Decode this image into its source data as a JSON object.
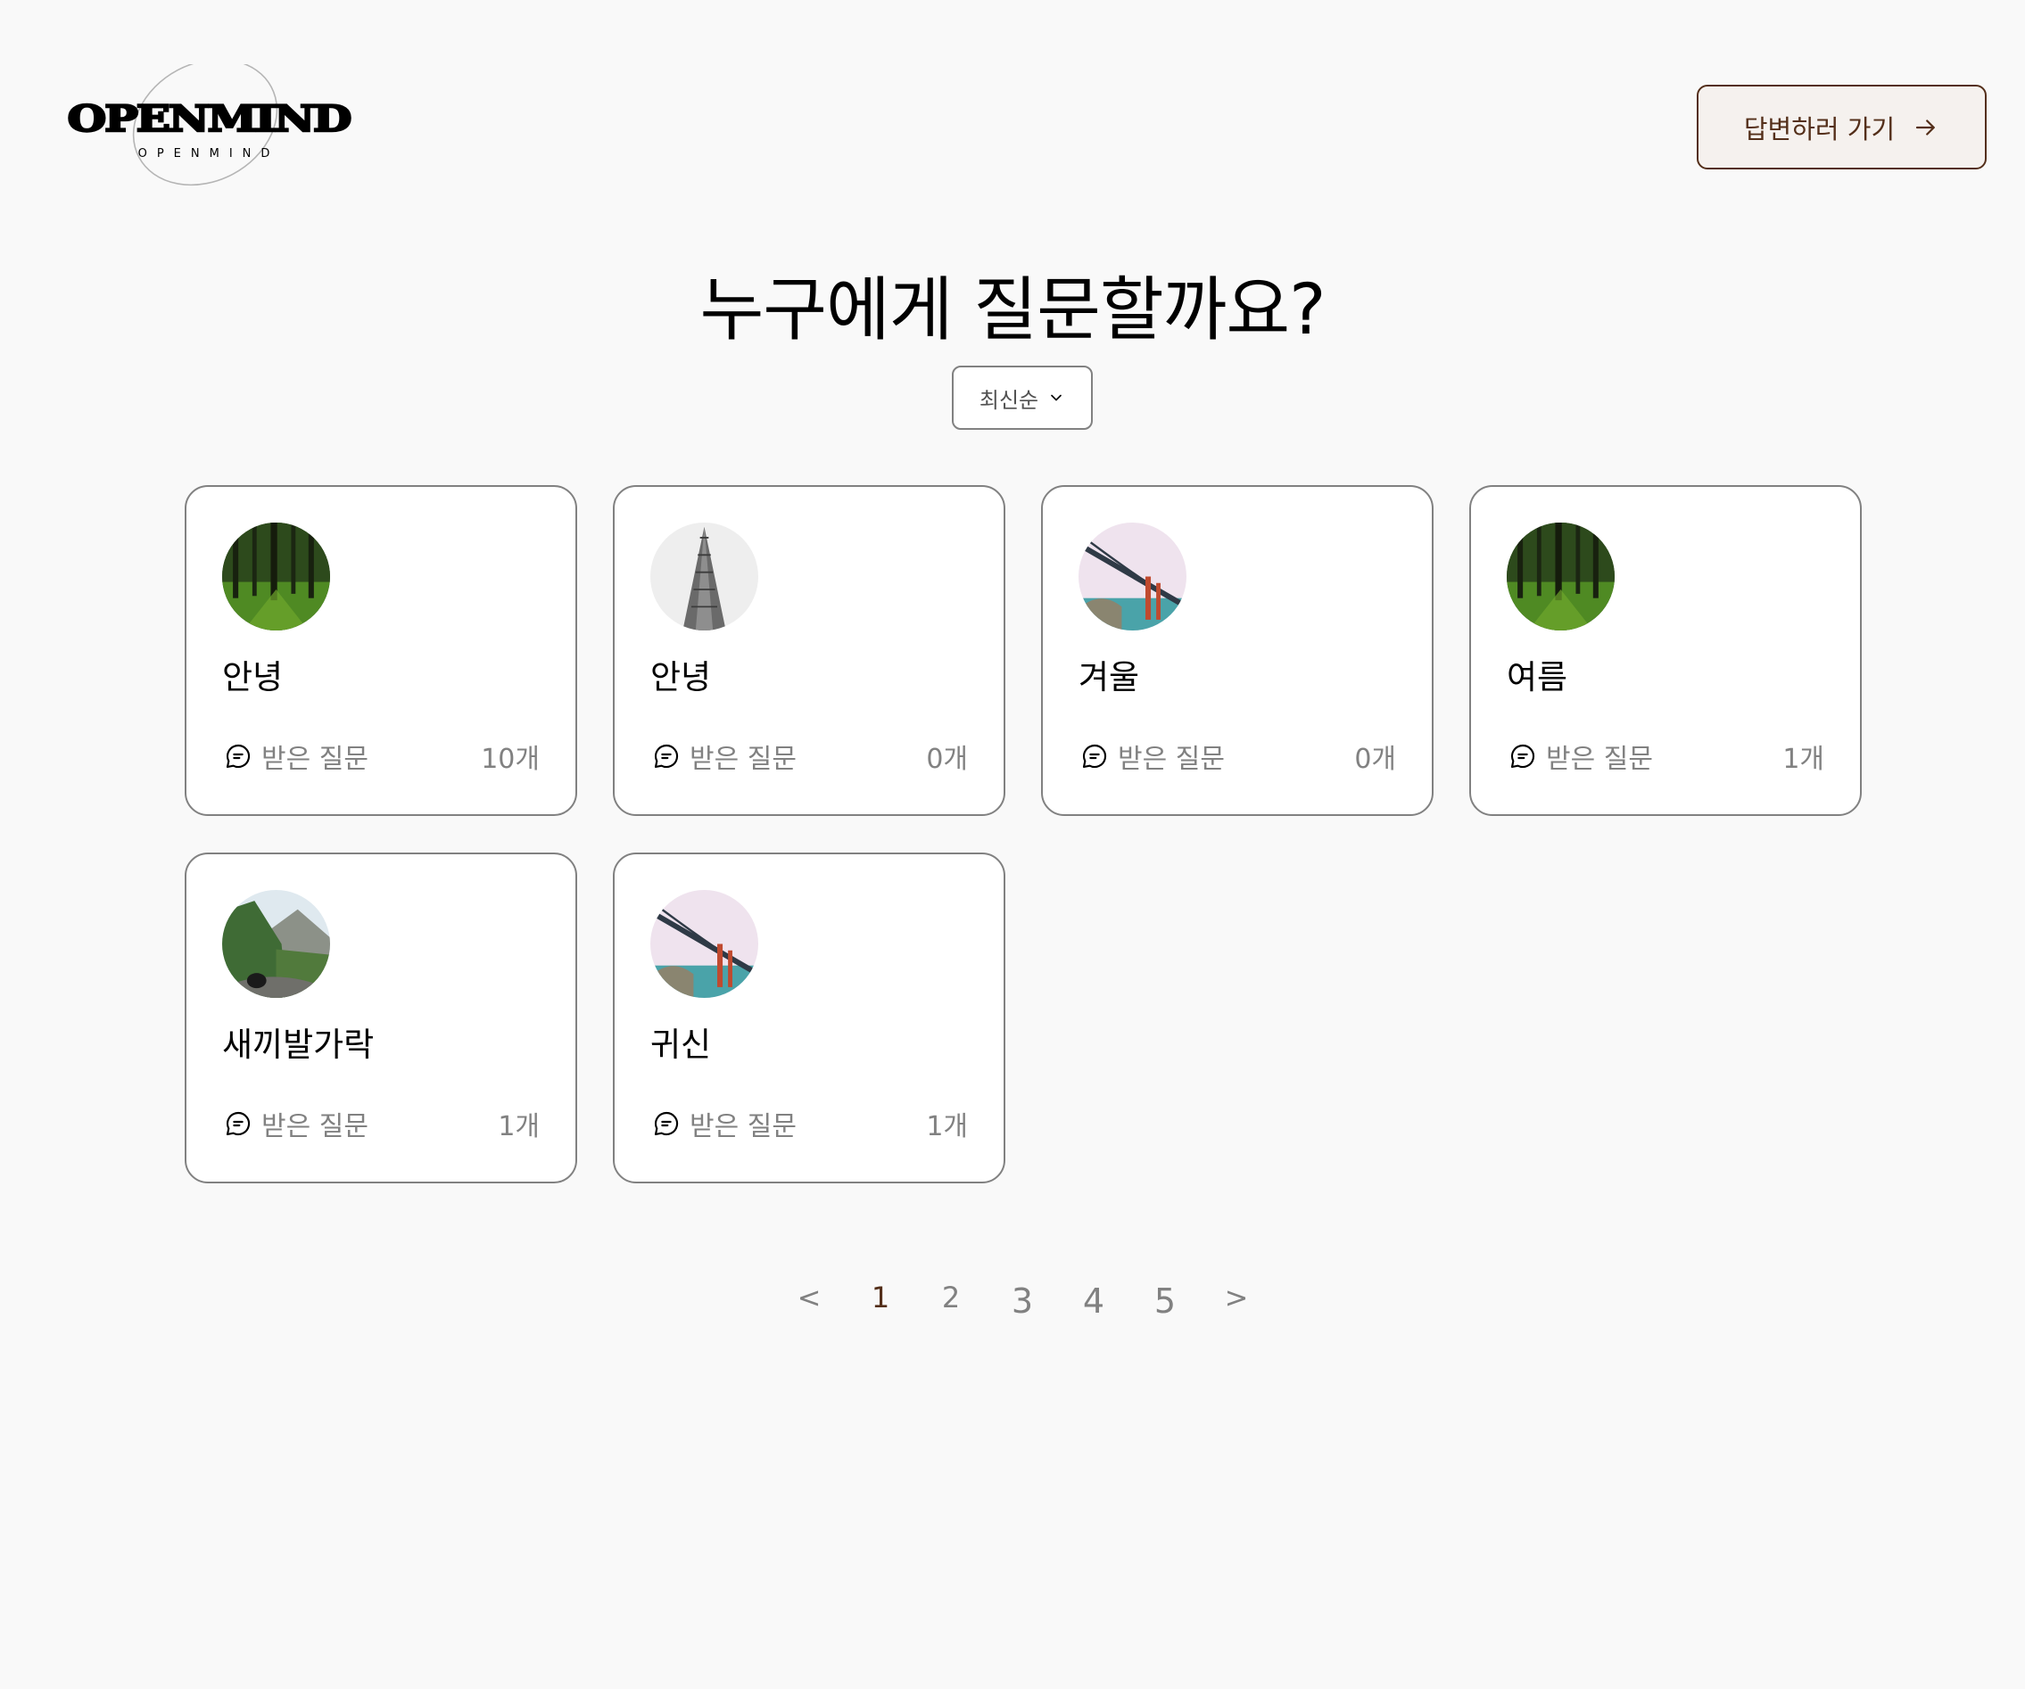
{
  "header": {
    "logo_text": "OPENMIND",
    "logo_subtext": "OPENMIND",
    "answer_button_label": "답변하러 가기"
  },
  "main": {
    "title": "누구에게 질문할까요?",
    "sort": {
      "selected": "최신순"
    }
  },
  "cards": [
    {
      "name": "안녕",
      "questions_label": "받은 질문",
      "count": "10개",
      "avatar": "forest"
    },
    {
      "name": "안녕",
      "questions_label": "받은 질문",
      "count": "0개",
      "avatar": "building"
    },
    {
      "name": "겨울",
      "questions_label": "받은 질문",
      "count": "0개",
      "avatar": "bridge"
    },
    {
      "name": "여름",
      "questions_label": "받은 질문",
      "count": "1개",
      "avatar": "forest"
    },
    {
      "name": "새끼발가락",
      "questions_label": "받은 질문",
      "count": "1개",
      "avatar": "mountain"
    },
    {
      "name": "귀신",
      "questions_label": "받은 질문",
      "count": "1개",
      "avatar": "bridge"
    }
  ],
  "pagination": {
    "prev": "<",
    "pages": [
      "1",
      "2",
      "3",
      "4",
      "5"
    ],
    "current": "1",
    "next": ">"
  },
  "colors": {
    "brown": "#542f1a",
    "gray": "#818181",
    "background": "#f9f9f9"
  }
}
